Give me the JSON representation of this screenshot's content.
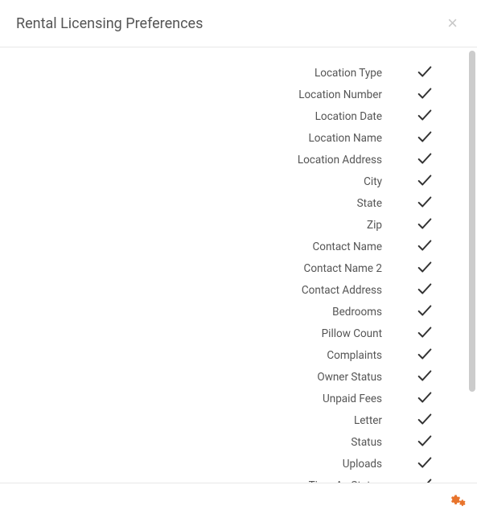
{
  "header": {
    "title": "Rental Licensing Preferences"
  },
  "preferences": [
    {
      "label": "Location Type",
      "checked": true
    },
    {
      "label": "Location Number",
      "checked": true
    },
    {
      "label": "Location Date",
      "checked": true
    },
    {
      "label": "Location Name",
      "checked": true
    },
    {
      "label": "Location Address",
      "checked": true
    },
    {
      "label": "City",
      "checked": true
    },
    {
      "label": "State",
      "checked": true
    },
    {
      "label": "Zip",
      "checked": true
    },
    {
      "label": "Contact Name",
      "checked": true
    },
    {
      "label": "Contact Name 2",
      "checked": true
    },
    {
      "label": "Contact Address",
      "checked": true
    },
    {
      "label": "Bedrooms",
      "checked": true
    },
    {
      "label": "Pillow Count",
      "checked": true
    },
    {
      "label": "Complaints",
      "checked": true
    },
    {
      "label": "Owner Status",
      "checked": true
    },
    {
      "label": "Unpaid Fees",
      "checked": true
    },
    {
      "label": "Letter",
      "checked": true
    },
    {
      "label": "Status",
      "checked": true
    },
    {
      "label": "Uploads",
      "checked": true
    },
    {
      "label": "Time As Status",
      "checked": true
    }
  ]
}
